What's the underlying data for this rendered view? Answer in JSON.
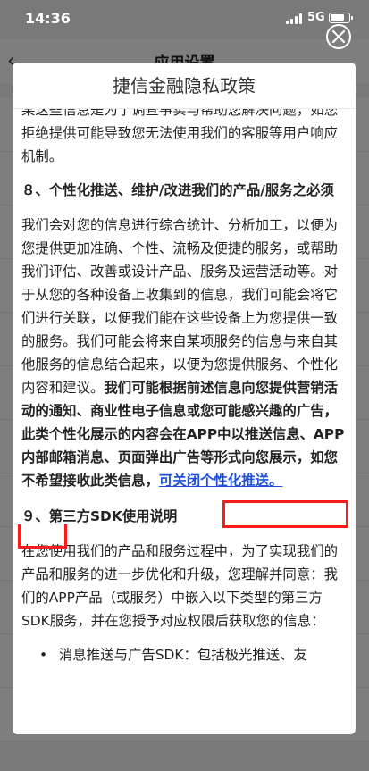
{
  "status_bar": {
    "time": "14:36",
    "network": "5G",
    "battery_level": 0.8
  },
  "underlay": {
    "title": "应用设置"
  },
  "modal": {
    "title": "捷信金融隐私政策",
    "top_partial": "某这些信息是为了调查事实与帮助您解决问题，",
    "para_top": "如您拒绝提供可能导致您无法使用我们的客服等用户响应机制。",
    "section8_heading": "８、个性化推送、维护/改进我们的产品/服务之必须",
    "section8_para1": "我们会对您的信息进行综合统计、分析加工，以便为您提供更加准确、个性、流畅及便捷的服务，或帮助我们评估、改善或设计产品、服务及运营活动等。对于从您的各种设备上收集到的信息，我们可能会将它们进行关联，以便我们能在这些设备上为您提供一致的服务。我们可能会将来自某项服务的信息与来自其他服务的信息结合起来，以便为您提供服务、个性化内容和建议。",
    "section8_para2_bold": "我们可能根据前述信息向您提供营销活动的通知、商业性电子信息或您可能感兴趣的广告，此类个性化展示的内容会在APP中以推送信息、APP内部邮箱消息、页面弹出广告等形式向您展示，如您不希望接收此类信息，",
    "section8_link": "可关闭个性化推送。",
    "section9_heading": "９、第三方SDK使用说明",
    "section9_para": "在您使用我们的产品和服务过程中，为了实现我们的产品和服务的进一步优化和升级，您理解并同意：我们的APP产品（或服务）中嵌入以下类型的第三方SDK服务，并在您授予对应权限后获取您的信息：",
    "list_item_partial": "消息推送与广告SDK：包括极光推送、友"
  }
}
